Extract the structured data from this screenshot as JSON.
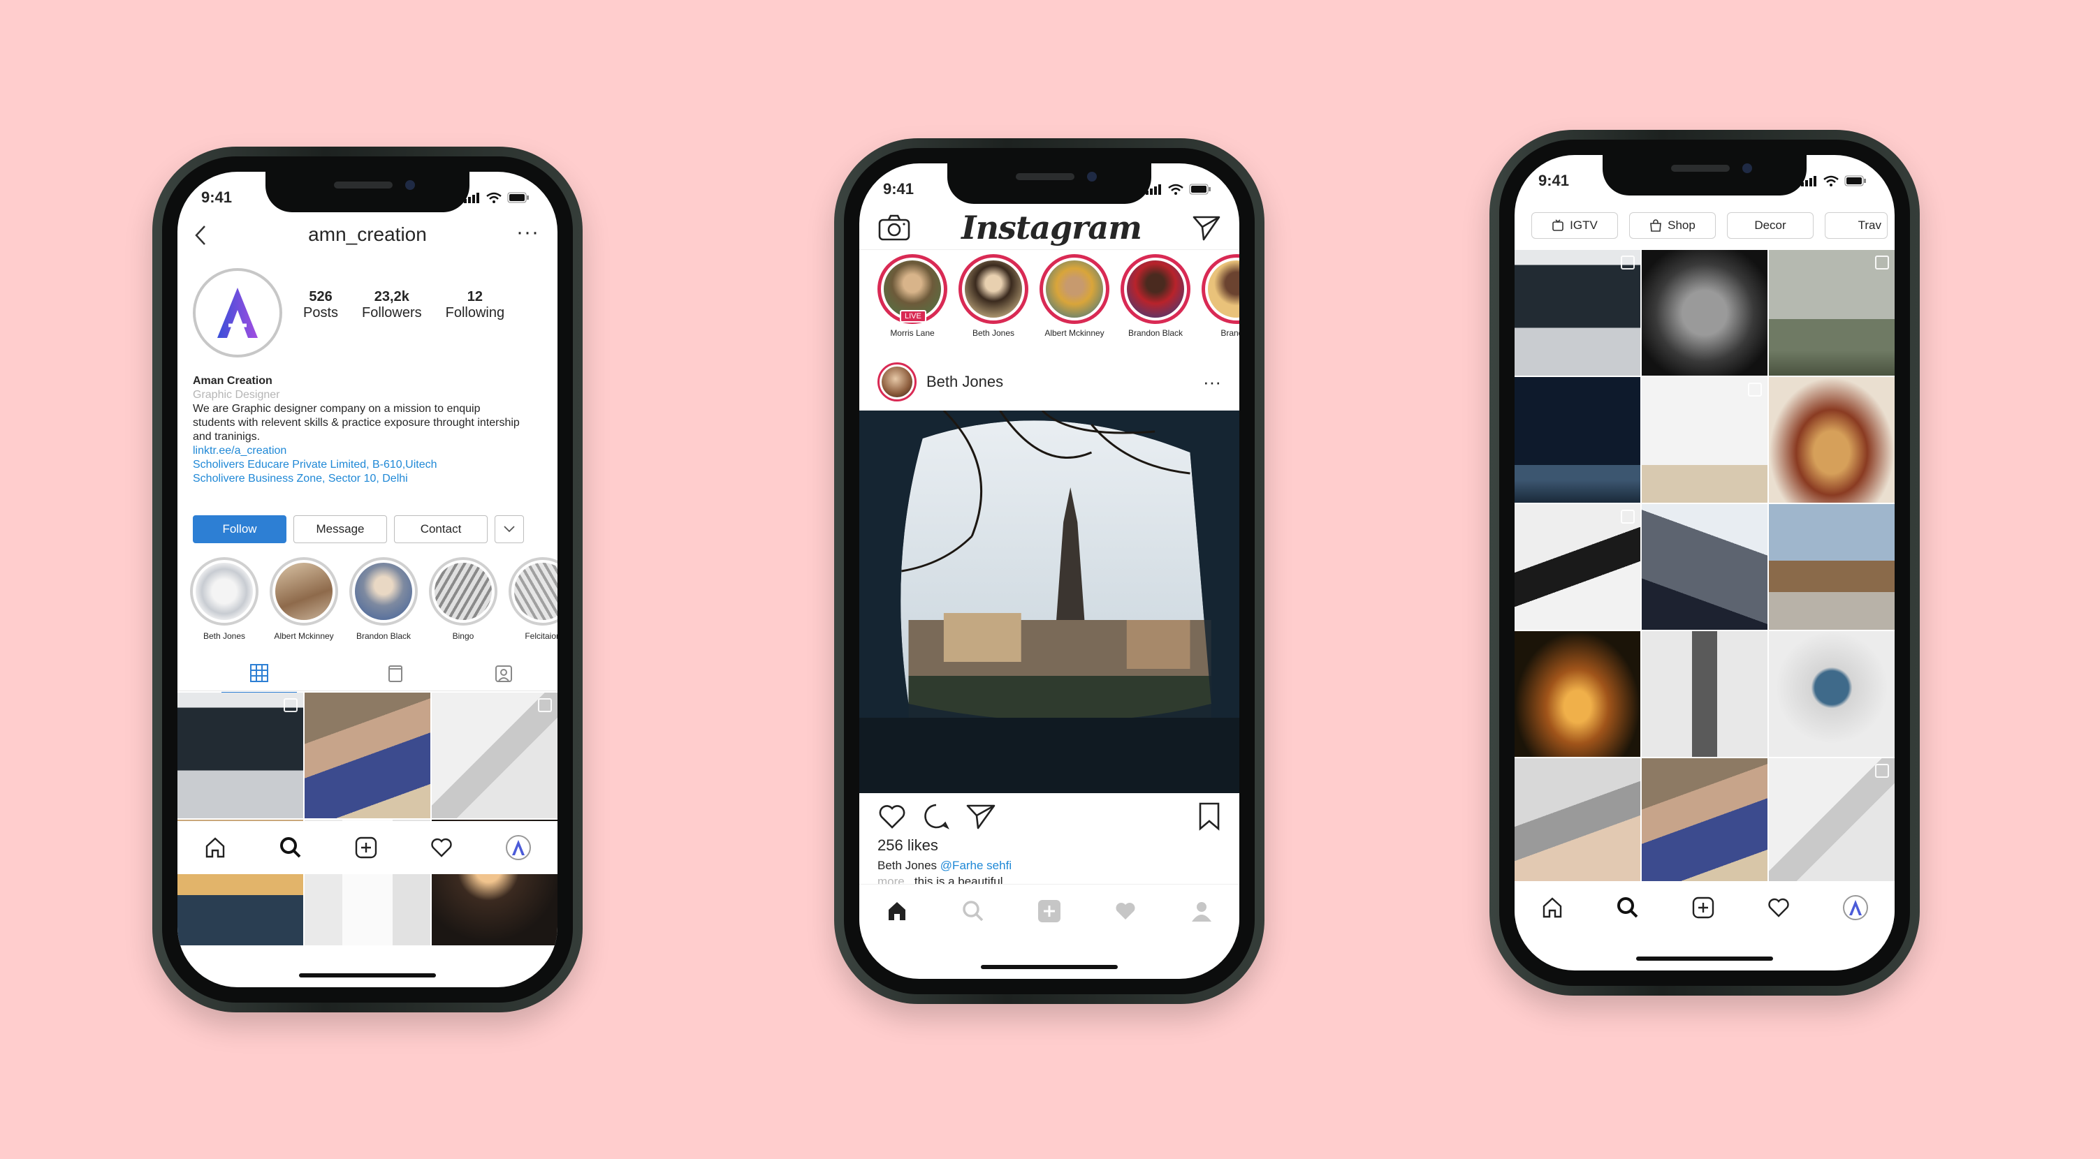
{
  "status_time": "9:41",
  "profile": {
    "username": "amn_creation",
    "back_icon": "chevron-left-icon",
    "more_label": "···",
    "avatar_letter": "A",
    "stats": [
      {
        "value": "526",
        "label": "Posts"
      },
      {
        "value": "23,2k",
        "label": "Followers"
      },
      {
        "value": "12",
        "label": "Following"
      }
    ],
    "bio": {
      "name": "Aman Creation",
      "category": "Graphic Designer",
      "description": "We are  Graphic designer company on a mission to enquip students with relevent skills & practice exposure throught intership and traninigs.",
      "link": "linktr.ee/a_creation",
      "address_line1": "Scholivers Educare Private Limited, B-610,Uitech",
      "address_line2": "Scholivere Business Zone, Sector 10, Delhi"
    },
    "buttons": {
      "follow": "Follow",
      "message": "Message",
      "contact": "Contact"
    },
    "highlights": [
      {
        "label": "Beth Jones",
        "color": "#cfd3d8"
      },
      {
        "label": "Albert Mckinney",
        "color": "#a8866a"
      },
      {
        "label": "Brandon Black",
        "color": "#7e8aa0"
      },
      {
        "label": "Bingo",
        "color": "#9a9a9a"
      },
      {
        "label": "Felcitaion",
        "color": "#bdbdbd"
      }
    ],
    "tabs": [
      "grid-icon",
      "igtv-icon",
      "tagged-icon"
    ],
    "accent": "#2d7fd4"
  },
  "feed": {
    "logo": "Instagram",
    "stories": [
      {
        "label": "Morris Lane",
        "live": "LIVE"
      },
      {
        "label": "Beth Jones"
      },
      {
        "label": "Albert Mckinney"
      },
      {
        "label": "Brandon Black"
      },
      {
        "label": "Brandon"
      }
    ],
    "post": {
      "author": "Beth Jones",
      "likes": "256 likes",
      "caption_author": "Beth Jones",
      "caption_mention": "@Farhe sehfi",
      "caption_more": "more...",
      "caption_text": "this is a beautiful"
    },
    "story_ring_color": "#d92a54"
  },
  "explore": {
    "chips": [
      {
        "label": "IGTV",
        "icon": "igtv-icon"
      },
      {
        "label": "Shop",
        "icon": "shop-bag-icon"
      },
      {
        "label": "Decor"
      },
      {
        "label": "Trav"
      }
    ]
  },
  "nav": [
    "home-icon",
    "search-icon",
    "add-post-icon",
    "heart-icon",
    "profile-icon"
  ]
}
